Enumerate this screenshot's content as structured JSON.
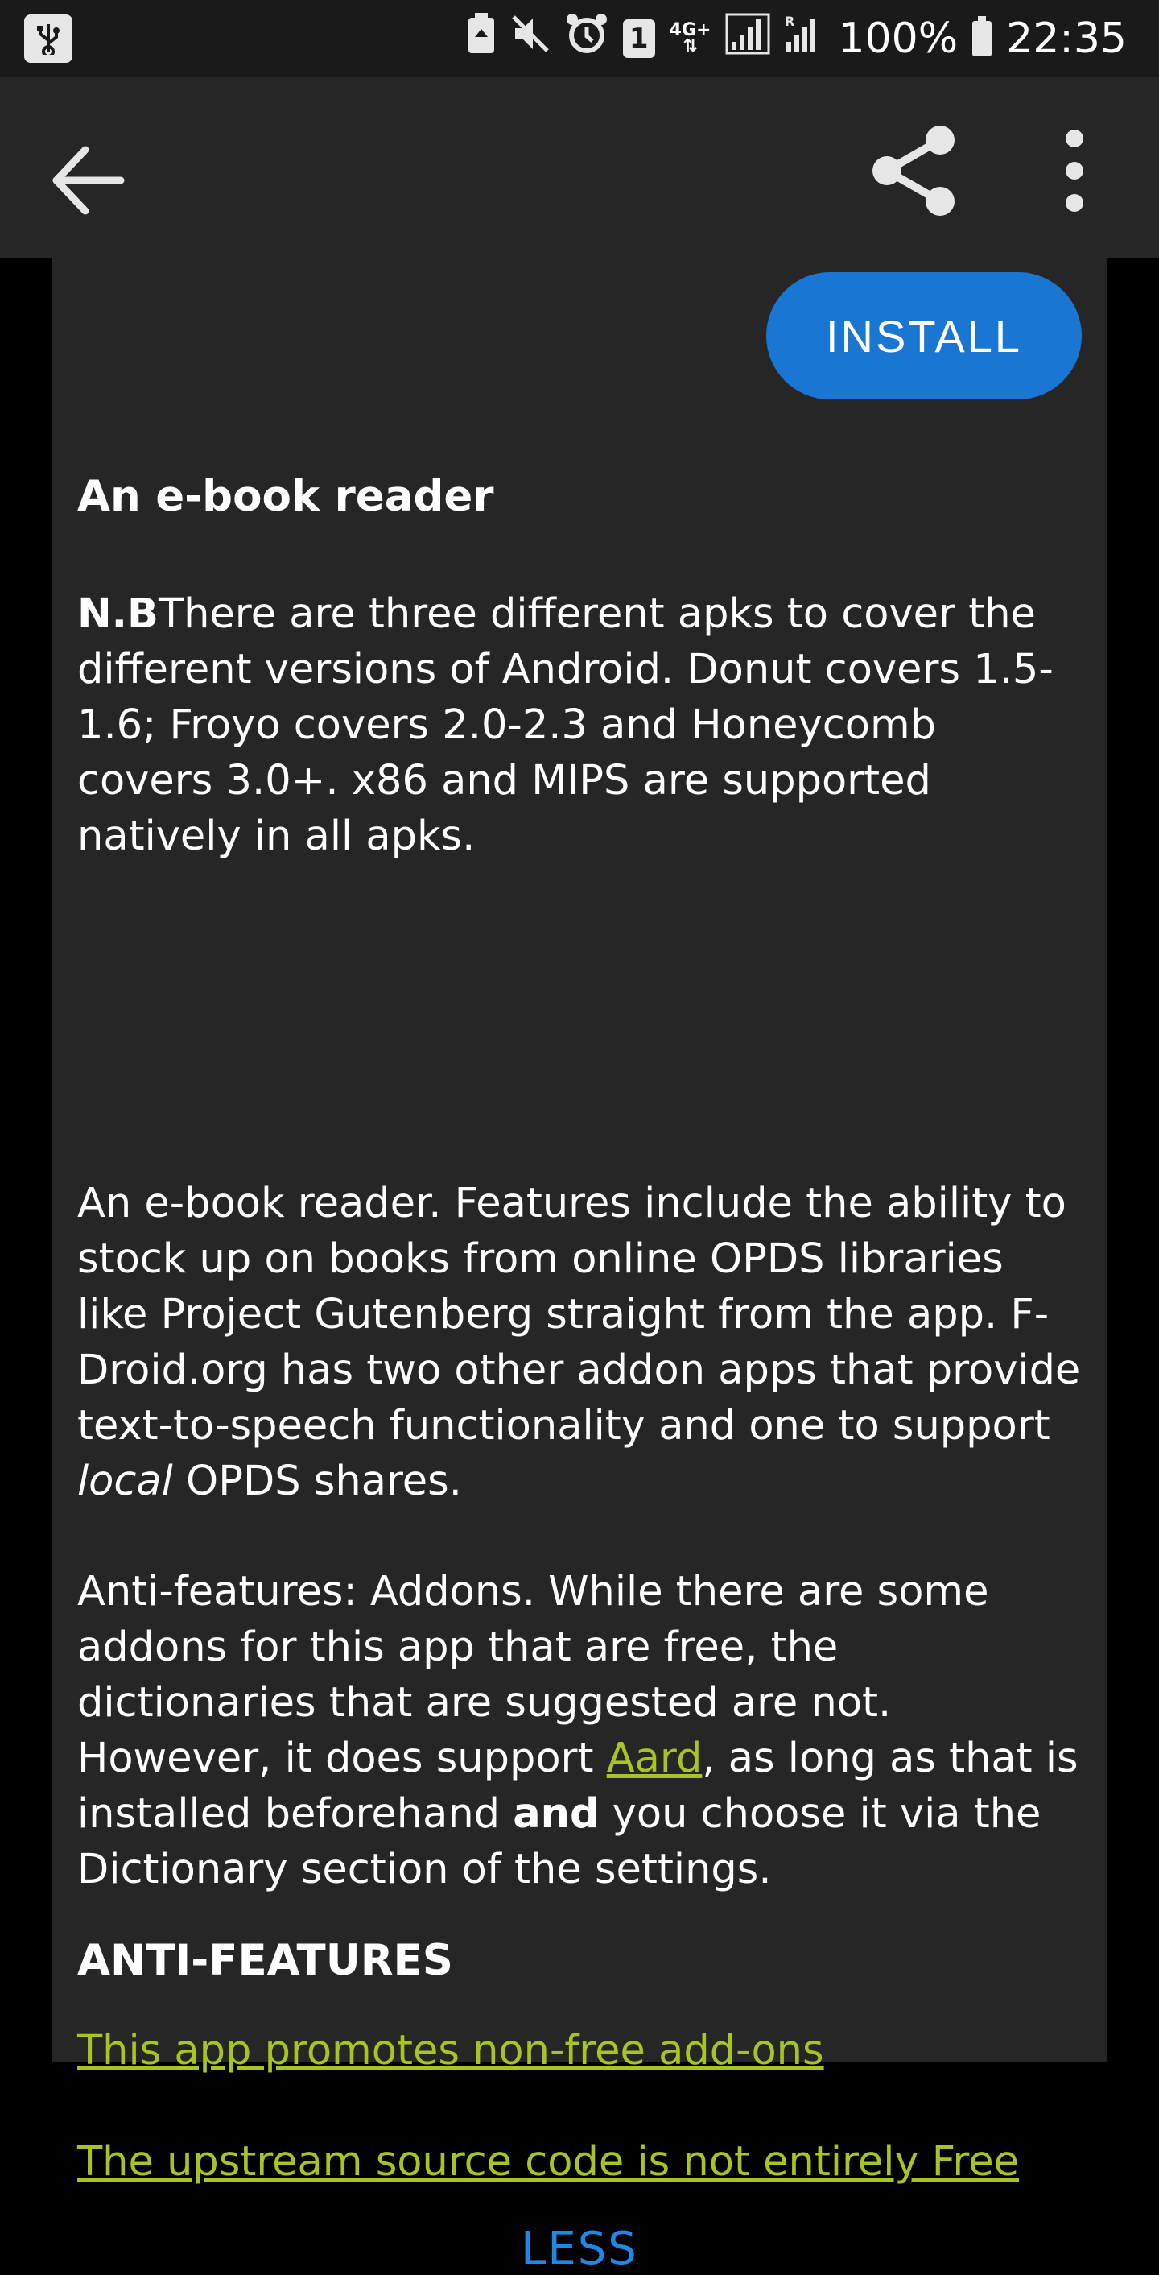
{
  "status_bar": {
    "sim_slot": "1",
    "network_type": "4G+",
    "roaming": "R",
    "battery": "100%",
    "time": "22:35"
  },
  "app_bar": {
    "back_icon": "arrow-left-icon",
    "share_icon": "share-icon",
    "more_icon": "more-vert-icon"
  },
  "install_label": "INSTALL",
  "summary": "An e-book reader",
  "description": {
    "p1_bold": "N.B",
    "p1_text": "There are three different apks to cover the different versions of Android. Donut covers 1.5-1.6; Froyo covers 2.0-2.3 and Honeycomb covers 3.0+. x86 and MIPS are supported natively in all apks.",
    "p2_before": "An e-book reader. Features include the ability to stock up on books from online OPDS libraries like Project Gutenberg straight from the app. F-Droid.org has two other addon apps that provide text-to-speech functionality and one to support ",
    "p2_italic": "local",
    "p2_after": " OPDS shares.",
    "p3_before": "Anti-features: Addons. While there are some addons for this app that are free, the dictionaries that are suggested are not. However, it does support ",
    "p3_link": "Aard",
    "p3_middle": ", as long as that is installed beforehand ",
    "p3_bold": "and",
    "p3_after": " you choose it via the Dictionary section of the settings."
  },
  "anti_features": {
    "heading": "ANTI-FEATURES",
    "items": [
      "This app promotes non-free add-ons",
      "The upstream source code is not entirely Free"
    ]
  },
  "less_label": "LESS",
  "colors": {
    "accent": "#1976d2",
    "link": "#a7c520",
    "background": "#262626"
  }
}
